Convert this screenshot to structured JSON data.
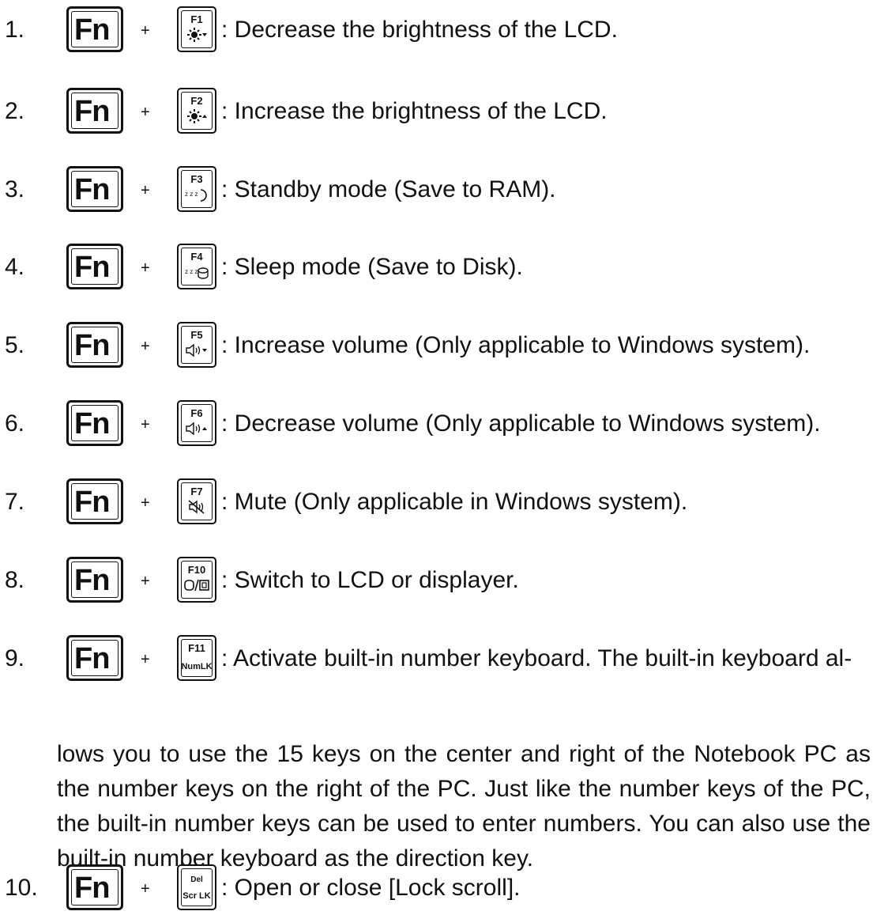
{
  "fn_label": "Fn",
  "plus": "+",
  "items": [
    {
      "num": "1.",
      "key": "F1",
      "icon": "brightness-down-icon",
      "text": ": Decrease the brightness of the LCD."
    },
    {
      "num": "2.",
      "key": "F2",
      "icon": "brightness-up-icon",
      "text": ": Increase the brightness of the LCD."
    },
    {
      "num": "3.",
      "key": "F3",
      "icon": "standby-moon-icon",
      "text": ": Standby mode (Save to RAM)."
    },
    {
      "num": "4.",
      "key": "F4",
      "icon": "sleep-disk-icon",
      "text": ": Sleep mode (Save to Disk)."
    },
    {
      "num": "5.",
      "key": "F5",
      "icon": "volume-down-icon",
      "text": ": Increase volume (Only applicable to Windows system)."
    },
    {
      "num": "6.",
      "key": "F6",
      "icon": "volume-up-icon",
      "text": ": Decrease volume (Only applicable to Windows system)."
    },
    {
      "num": "7.",
      "key": "F7",
      "icon": "mute-icon",
      "text": ": Mute (Only applicable in Windows system)."
    },
    {
      "num": "8.",
      "key": "F10",
      "icon": "display-switch-icon",
      "text": ": Switch to LCD or displayer."
    },
    {
      "num": "9.",
      "key": "F11",
      "sub": "NumLK",
      "icon": "numlock-text",
      "text": ": Activate built-in number keyboard. The built-in keyboard al-"
    },
    {
      "num": "10.",
      "key": "Del",
      "sub": "Scr LK",
      "icon": "scroll-lock-text",
      "text": ": Open or close [Lock scroll]."
    }
  ],
  "item9_continuation": "lows you to use the 15 keys on the center and right of the Notebook PC as the number keys on the right of the PC. Just like the number keys of the PC, the built-in number keys can be used to enter numbers. You can also use the built-in number keyboard as the direction key."
}
